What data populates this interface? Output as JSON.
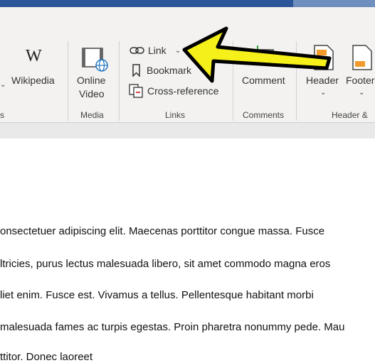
{
  "ribbon": {
    "wikipedia": {
      "label": "Wikipedia",
      "icon": "wikipedia-icon"
    },
    "online_video": {
      "label_line1": "Online",
      "label_line2": "Video",
      "icon": "online-video-icon"
    },
    "media_group_label": "Media",
    "link": {
      "label": "Link",
      "icon": "link-icon"
    },
    "bookmark": {
      "label": "Bookmark",
      "icon": "bookmark-icon"
    },
    "cross_reference": {
      "label": "Cross-reference",
      "icon": "cross-reference-icon"
    },
    "links_group_label": "Links",
    "comment": {
      "label": "Comment",
      "icon": "new-comment-icon"
    },
    "comments_group_label": "Comments",
    "header": {
      "label": "Header",
      "icon": "header-icon"
    },
    "footer": {
      "label": "Footer",
      "icon": "footer-icon"
    },
    "header_footer_group_label": "Header &",
    "left_group_label_fragment": "s"
  },
  "document": {
    "lines": [
      "onsectetuer adipiscing elit. Maecenas porttitor congue massa. Fusce",
      "ltricies, purus lectus malesuada libero, sit amet commodo magna eros",
      "liet enim. Fusce est. Vivamus a tellus. Pellentesque habitant morbi",
      "malesuada fames ac turpis egestas. Proin pharetra nonummy pede. Mau",
      "ttitor. Donec laoreet"
    ]
  },
  "colors": {
    "title_bar": "#2b579a",
    "ribbon_bg": "#f3f2f1",
    "arrow_fill": "#f5ef1a",
    "arrow_stroke": "#000000",
    "header_footer_accent": "#f29b2c"
  }
}
